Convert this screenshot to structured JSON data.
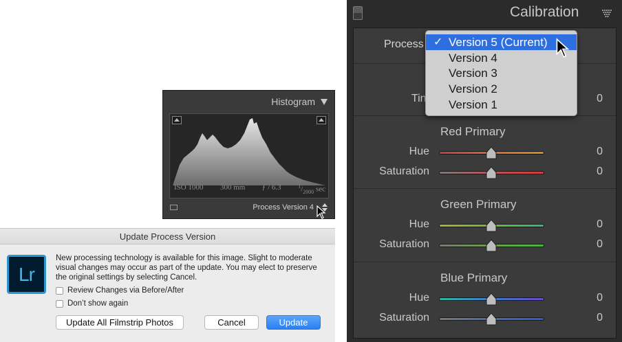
{
  "histogram": {
    "title": "Histogram",
    "iso": "ISO 1000",
    "focal": "300 mm",
    "aperture": "ƒ / 6.3",
    "shutter_num": "1",
    "shutter_den": "2000",
    "shutter_unit": "sec",
    "process_label": "Process Version 4"
  },
  "dialog": {
    "title": "Update Process Version",
    "logo_text": "Lr",
    "message": "New processing technology is available for this image. Slight to moderate visual changes may occur as part of the update. You may elect to preserve the original settings by selecting Cancel.",
    "checkbox_review": "Review Changes via Before/After",
    "checkbox_dont_show": "Don’t show again",
    "btn_update_all": "Update All Filmstrip Photos",
    "btn_cancel": "Cancel",
    "btn_update": "Update"
  },
  "calibration": {
    "title": "Calibration",
    "process_label": "Process",
    "tint_label": "Tint",
    "tint_value": "0",
    "dropdown": {
      "options": [
        "Version 5 (Current)",
        "Version 4",
        "Version 3",
        "Version 2",
        "Version 1"
      ],
      "checkmark": "✓"
    },
    "sections": [
      {
        "title": "Red Primary",
        "hue_label": "Hue",
        "hue_value": "0",
        "sat_label": "Saturation",
        "sat_value": "0"
      },
      {
        "title": "Green Primary",
        "hue_label": "Hue",
        "hue_value": "0",
        "sat_label": "Saturation",
        "sat_value": "0"
      },
      {
        "title": "Blue Primary",
        "hue_label": "Hue",
        "hue_value": "0",
        "sat_label": "Saturation",
        "sat_value": "0"
      }
    ]
  },
  "colors": {
    "panel_bg": "#3b3b3b",
    "dialog_bg": "#ececec",
    "accent_blue": "#2d6ee0",
    "lr_logo_blue": "#43b6ee"
  }
}
